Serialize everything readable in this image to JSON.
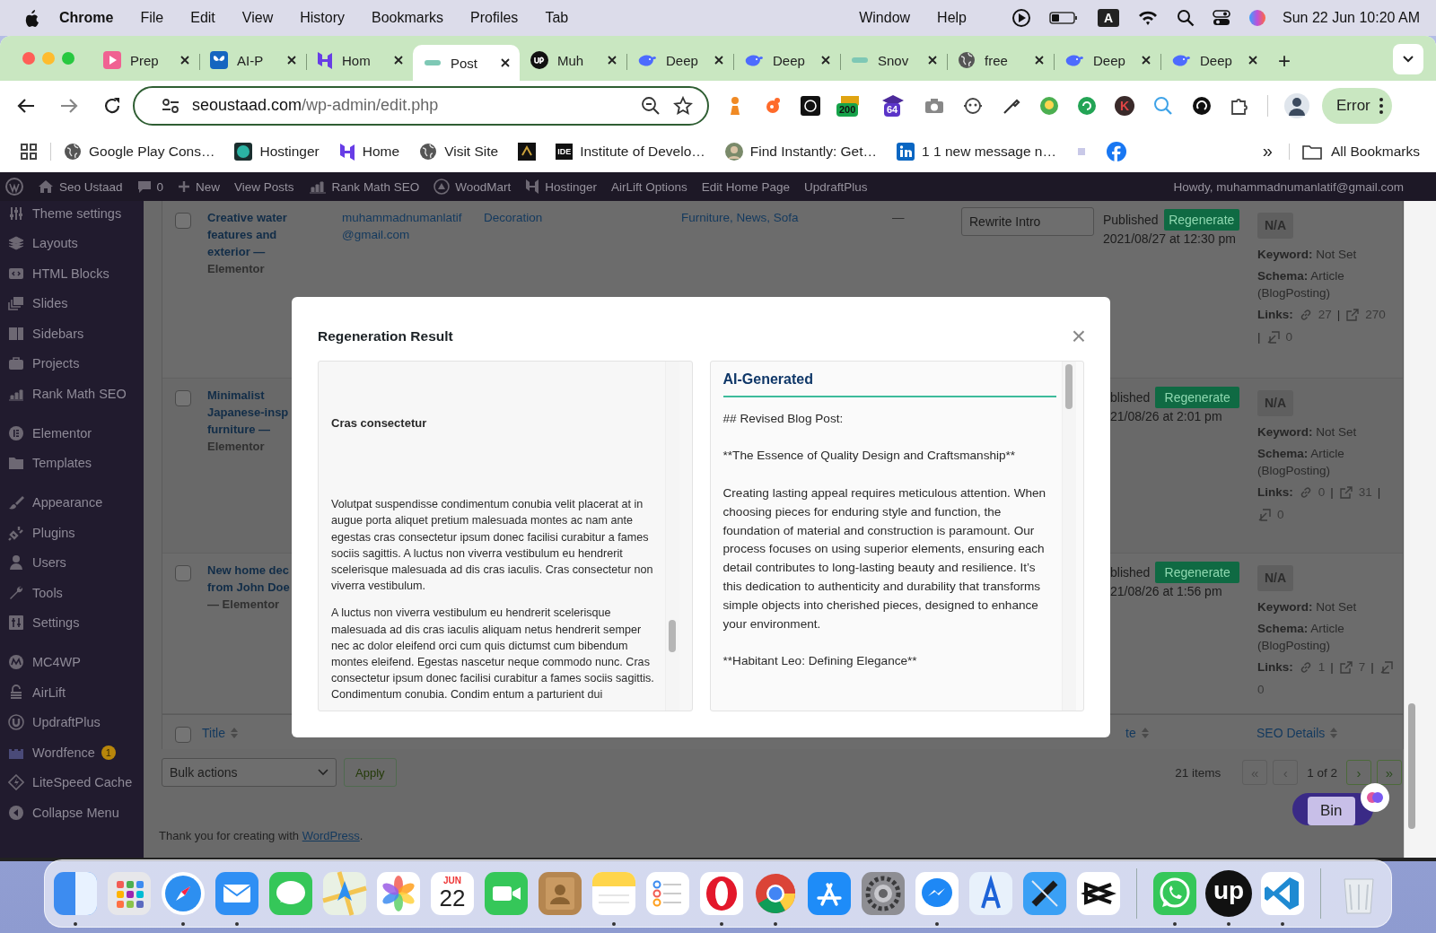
{
  "mac_menu_bar": {
    "app": "Chrome",
    "menus": [
      "File",
      "Edit",
      "View",
      "History",
      "Bookmarks",
      "Profiles",
      "Tab"
    ],
    "right_menus": [
      "Window",
      "Help"
    ],
    "input_source": "A",
    "clock": "Sun 22 Jun  10:20 AM"
  },
  "browser": {
    "tabs": [
      {
        "kind": "pdf",
        "label": "Prep",
        "selected": false
      },
      {
        "kind": "butterfly",
        "label": "AI-P",
        "selected": false
      },
      {
        "kind": "hostinger",
        "label": "Hom",
        "selected": false
      },
      {
        "kind": "seo",
        "label": "Post",
        "selected": true
      },
      {
        "kind": "upwork",
        "label": "Muh",
        "selected": false
      },
      {
        "kind": "whale",
        "label": "Deep",
        "selected": false
      },
      {
        "kind": "whale",
        "label": "Deep",
        "selected": false
      },
      {
        "kind": "seo",
        "label": "Snov",
        "selected": false
      },
      {
        "kind": "globe",
        "label": "free",
        "selected": false
      },
      {
        "kind": "whale",
        "label": "Deep",
        "selected": false
      },
      {
        "kind": "whale",
        "label": "Deep",
        "selected": false
      }
    ],
    "new_tab": "+",
    "url_host": "seoustaad.com",
    "url_path": "/wp-admin/edit.php",
    "extensions": [
      {
        "kind": "chess"
      },
      {
        "kind": "dots"
      },
      {
        "kind": "square"
      },
      {
        "kind": "green",
        "badge": "200"
      },
      {
        "kind": "hat",
        "badge": "64"
      },
      {
        "kind": "camera"
      },
      {
        "kind": "robot"
      },
      {
        "kind": "dropper"
      },
      {
        "kind": "bulb"
      },
      {
        "kind": "ring"
      },
      {
        "kind": "letter",
        "label": "K"
      },
      {
        "kind": "magnifier"
      },
      {
        "kind": "blackring"
      },
      {
        "kind": "puzzle"
      }
    ],
    "error_button": "Error",
    "bookmarks": [
      {
        "kind": "apps"
      },
      {
        "kind": "globe",
        "label": "Google Play Cons…"
      },
      {
        "kind": "teal",
        "label": "Hostinger"
      },
      {
        "kind": "hostinger",
        "label": "Home"
      },
      {
        "kind": "globe",
        "label": "Visit Site"
      },
      {
        "kind": "dark"
      },
      {
        "kind": "ide",
        "favicon_text": "IDE",
        "label": "Institute of Develo…"
      },
      {
        "kind": "avatar",
        "label": "Find Instantly: Get…"
      },
      {
        "kind": "linkedin",
        "label": "1 1 new message n…"
      },
      {
        "kind": "tiny"
      },
      {
        "kind": "facebook"
      }
    ],
    "more_bookmarks": "»",
    "all_bookmarks": "All Bookmarks"
  },
  "admin_bar": {
    "items": [
      {
        "kind": "wp"
      },
      {
        "kind": "home",
        "label": "Seo Ustaad"
      },
      {
        "kind": "comment",
        "label": "0"
      },
      {
        "kind": "plus",
        "label": "New"
      },
      {
        "kind": "none",
        "label": "View Posts"
      },
      {
        "kind": "chart",
        "label": "Rank Math SEO"
      },
      {
        "kind": "circle",
        "label": "WoodMart"
      },
      {
        "kind": "hostinger",
        "label": "Hostinger"
      },
      {
        "kind": "none",
        "label": "AirLift Options"
      },
      {
        "kind": "none",
        "label": "Edit Home Page"
      },
      {
        "kind": "none",
        "label": "UpdraftPlus"
      }
    ],
    "greeting": "Howdy, muhammadnumanlatif@gmail.com"
  },
  "sidebar": {
    "groups": [
      [
        {
          "label": "Theme settings"
        },
        {
          "label": "Layouts"
        },
        {
          "label": "HTML Blocks"
        },
        {
          "label": "Slides"
        },
        {
          "label": "Sidebars"
        },
        {
          "label": "Projects"
        },
        {
          "label": "Rank Math SEO"
        }
      ],
      [
        {
          "label": "Elementor"
        },
        {
          "label": "Templates"
        }
      ],
      [
        {
          "label": "Appearance"
        },
        {
          "label": "Plugins"
        },
        {
          "label": "Users"
        },
        {
          "label": "Tools"
        },
        {
          "label": "Settings"
        }
      ],
      [
        {
          "label": "MC4WP"
        },
        {
          "label": "AirLift"
        },
        {
          "label": "UpdraftPlus"
        },
        {
          "label": "Wordfence",
          "badge": "1"
        },
        {
          "label": "LiteSpeed Cache"
        },
        {
          "label": "Collapse Menu"
        }
      ]
    ]
  },
  "table": {
    "rows": [
      {
        "checked": false,
        "title": "Creative water\nfeatures and\nexterior —",
        "state": "Elementor",
        "author": "muhammadnumanlatif\n@gmail.com",
        "categories": [
          "Decoration"
        ],
        "tags": "Furniture, News, Sofa",
        "comments": "—",
        "ai_action": "Rewrite Intro",
        "status": "Published",
        "date": "2021/08/27 at 12:30 pm",
        "regenerate": "Regenerate",
        "seo": {
          "score": "N/A",
          "keyword": "**Keyword:** Not Set",
          "schema": "**Schema:** Article (BlogPosting)",
          "links_label": "Links:",
          "internal": "27",
          "external": "270",
          "incoming": "0",
          "separator": "|"
        }
      },
      {
        "checked": false,
        "title": "Minimalist\nJapanese-insp\nfurniture —",
        "state": "Elementor",
        "status": "blished",
        "date": "21/08/26 at 2:01 pm",
        "regenerate": "Regenerate",
        "seo": {
          "score": "N/A",
          "keyword": "**Keyword:** Not Set",
          "schema": "**Schema:** Article (BlogPosting)",
          "links_label": "Links:",
          "internal": "0",
          "external": "31",
          "incoming": "0",
          "separator": "|"
        }
      },
      {
        "checked": false,
        "title": "New home dec\nfrom John Doe",
        "state": "— Elementor",
        "status": "blished",
        "date": "21/08/26 at 1:56 pm",
        "regenerate": "Regenerate",
        "seo": {
          "score": "N/A",
          "keyword": "**Keyword:** Not Set",
          "schema": "**Schema:** Article (BlogPosting)",
          "links_label": "Links:",
          "internal": "1",
          "external": "7",
          "incoming": "0",
          "separator": "|"
        }
      }
    ],
    "footer_columns": [
      {
        "label": "Title"
      },
      {
        "label": "te"
      },
      {
        "label": "SEO Details"
      }
    ],
    "footer_checked": false
  },
  "tablenav": {
    "bulk_actions": "Bulk actions",
    "apply": "Apply",
    "count": "21 items",
    "first": "«",
    "prev": "‹",
    "page": "1 of 2",
    "next": "›",
    "last": "»"
  },
  "footer": {
    "text_before": "Thank you for creating with",
    "link": "WordPress",
    "text_after": "."
  },
  "tooltip": "Bin",
  "modal": {
    "title": "Regeneration Result",
    "close": "×",
    "original": {
      "heading": "Cras consectetur",
      "paragraphs": [
        "Volutpat suspendisse condimentum conubia velit placerat at in augue porta aliquet pretium malesuada montes ac nam ante egestas cras consectetur ipsum donec facilisi curabitur a fames sociis sagittis. A luctus non viverra vestibulum eu hendrerit scelerisque malesuada ad dis cras iaculis. Cras consectetur non viverra vestibulum.",
        "A luctus non viverra vestibulum eu hendrerit scelerisque malesuada ad dis cras iaculis aliquam netus hendrerit semper nec ac dolor eleifend orci cum quis dictumst cum bibendum montes eleifend. Egestas nascetur neque commodo nunc. Cras consectetur ipsum donec facilisi curabitur a fames sociis sagittis. Condimentum conubia. Condim entum a parturient dui"
      ]
    },
    "generated": {
      "heading": "AI-Generated",
      "paragraphs": [
        "## Revised Blog Post:",
        "**The Essence of Quality Design and Craftsmanship**",
        "Creating lasting appeal requires meticulous attention. When choosing pieces for enduring style and function, the foundation of material and construction is paramount. Our process focuses on using superior elements, ensuring each detail contributes to long-lasting beauty and resilience. It’s this dedication to authenticity and durability that transforms simple objects into cherished pieces, designed to enhance your environment.",
        "**Habitant Leo: Defining Elegance**"
      ]
    }
  },
  "dock": {
    "items": [
      {
        "kind": "finder",
        "running": true
      },
      {
        "kind": "launchpad",
        "running": false
      },
      {
        "kind": "safari",
        "running": true
      },
      {
        "kind": "mail",
        "running": true
      },
      {
        "kind": "messages",
        "running": false
      },
      {
        "kind": "maps",
        "running": false
      },
      {
        "kind": "photos",
        "running": false
      },
      {
        "kind": "calendar",
        "month": "JUN",
        "day": "22",
        "running": false
      },
      {
        "kind": "facetime",
        "running": false
      },
      {
        "kind": "contacts",
        "running": false
      },
      {
        "kind": "notes",
        "running": true
      },
      {
        "kind": "reminders",
        "running": false
      },
      {
        "kind": "opera",
        "running": true
      },
      {
        "kind": "chrome",
        "running": true
      },
      {
        "kind": "appstore",
        "running": false
      },
      {
        "kind": "settings",
        "running": false
      },
      {
        "kind": "messenger",
        "running": true
      },
      {
        "kind": "instruments",
        "running": false
      },
      {
        "kind": "xcode",
        "running": false
      },
      {
        "kind": "capcut",
        "running": false
      },
      {
        "kind": "separator"
      },
      {
        "kind": "whatsapp",
        "running": true
      },
      {
        "kind": "upwork",
        "label": "up",
        "running": true
      },
      {
        "kind": "vscode",
        "running": true
      },
      {
        "kind": "separator"
      },
      {
        "kind": "trash",
        "running": false
      }
    ]
  }
}
